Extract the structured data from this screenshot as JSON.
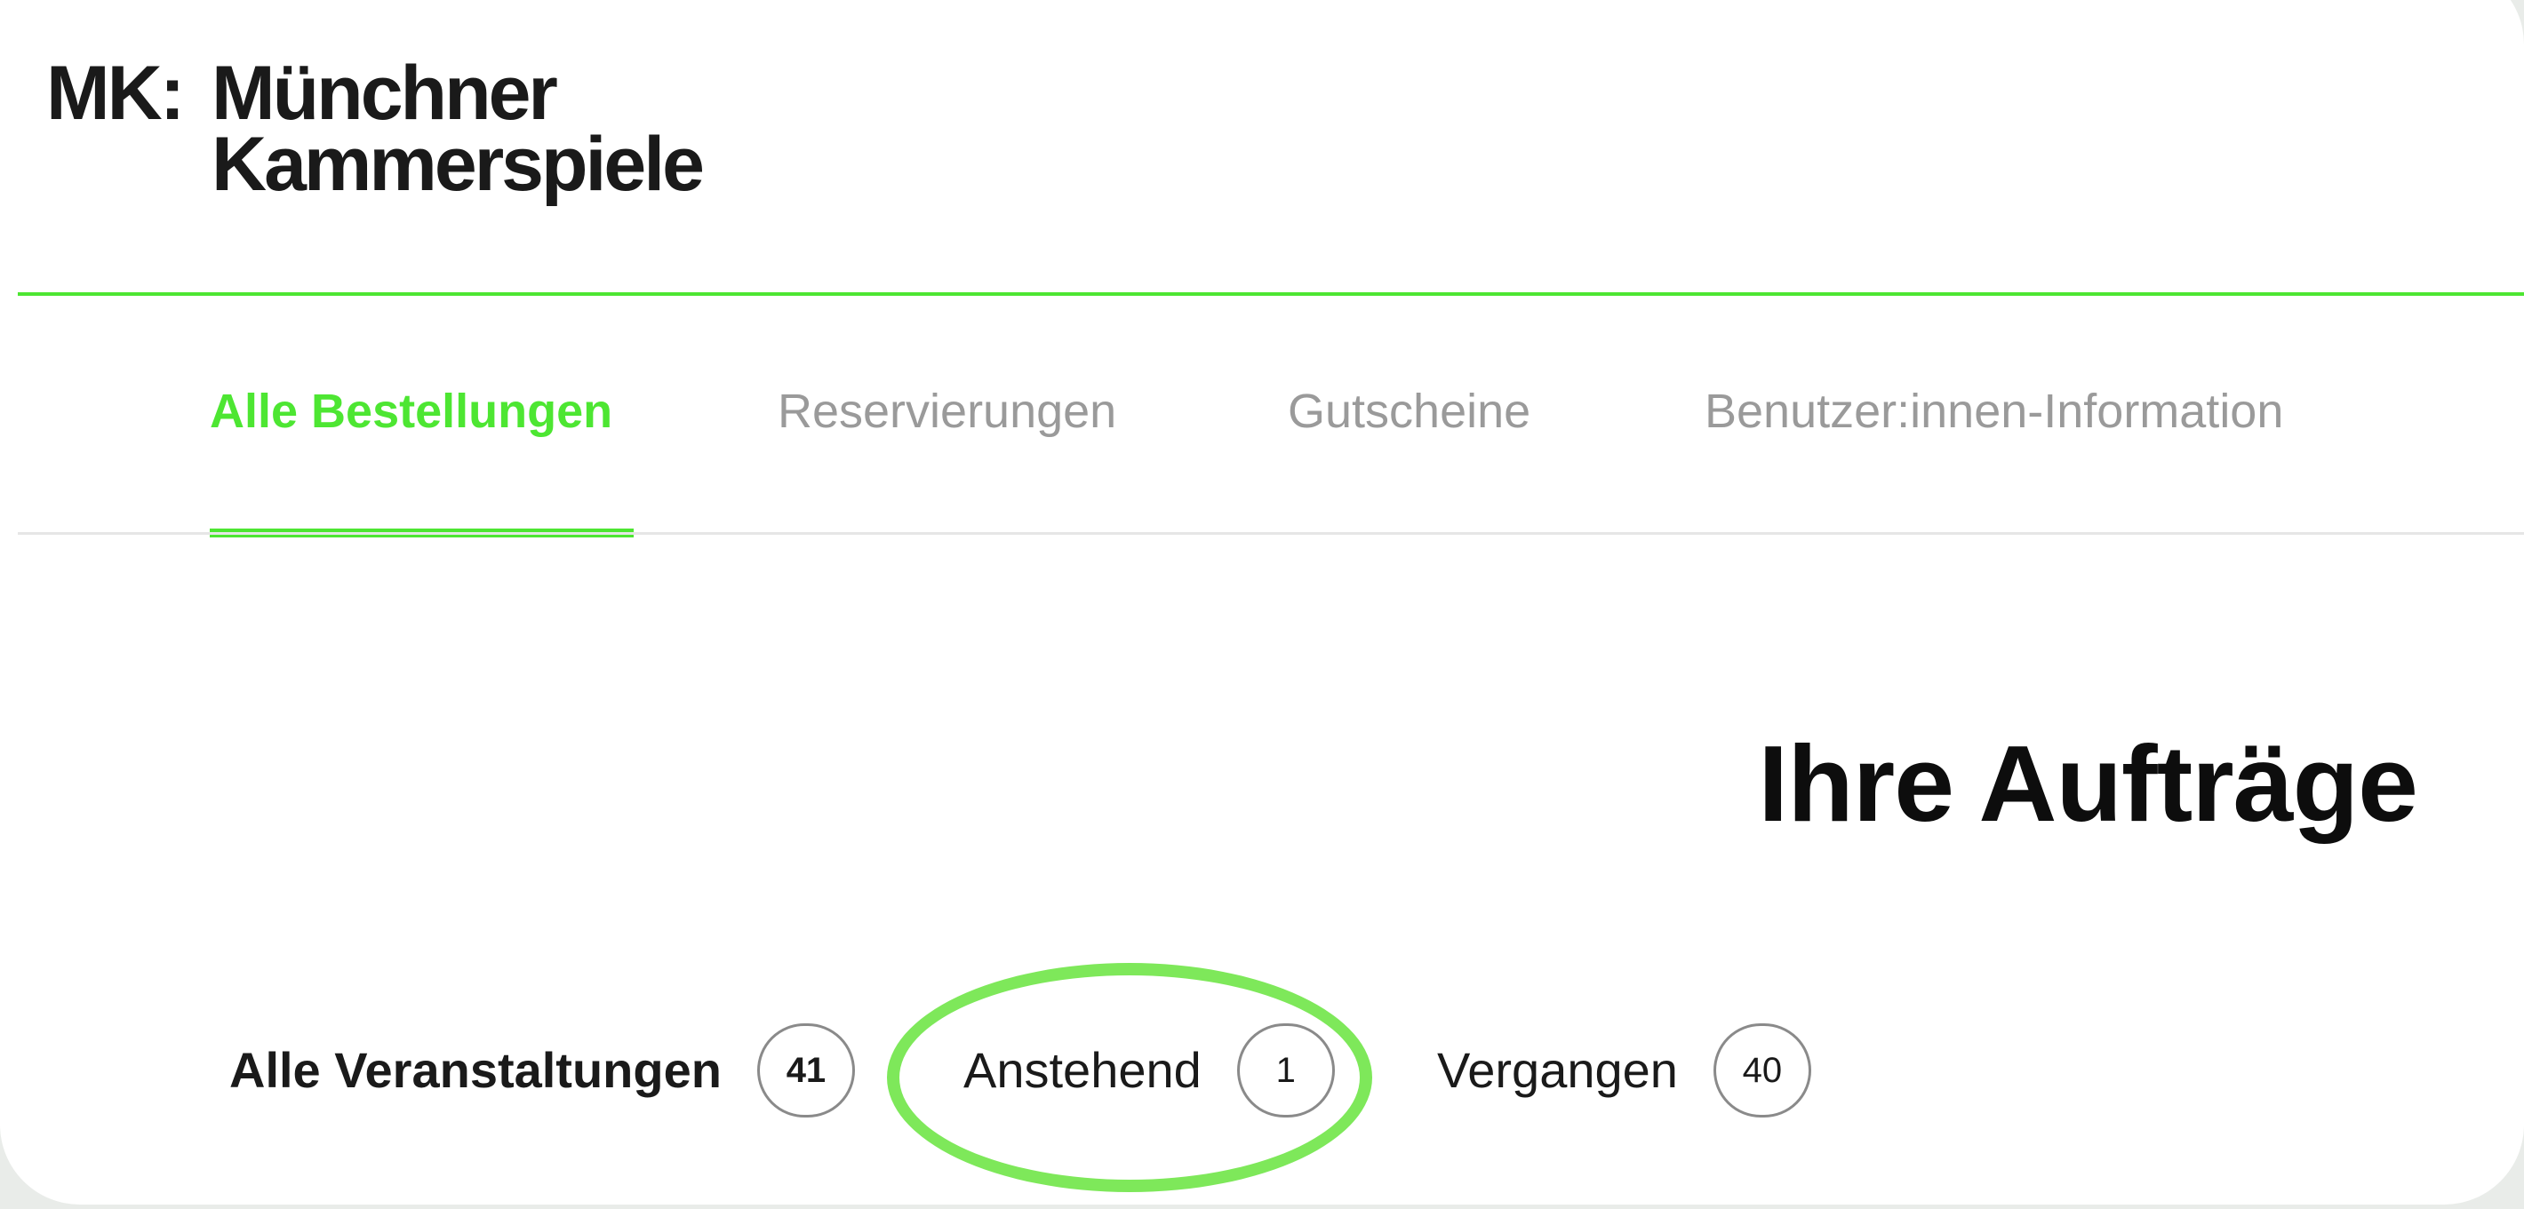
{
  "logo": {
    "prefix": "MK:",
    "line1": "Münchner",
    "line2": "Kammerspiele"
  },
  "colors": {
    "accent": "#4de632",
    "highlight": "#7ee85a",
    "tab_inactive": "#9a9a9a",
    "text": "#1a1a1a"
  },
  "tabs": [
    {
      "label": "Alle Bestellungen",
      "active": true
    },
    {
      "label": "Reservierungen",
      "active": false
    },
    {
      "label": "Gutscheine",
      "active": false
    },
    {
      "label": "Benutzer:innen-Information",
      "active": false
    }
  ],
  "main": {
    "title": "Ihre Aufträge"
  },
  "filters": [
    {
      "label": "Alle Veranstaltungen",
      "count": "41",
      "selected": true
    },
    {
      "label": "Anstehend",
      "count": "1",
      "selected": false,
      "highlighted": true
    },
    {
      "label": "Vergangen",
      "count": "40",
      "selected": false
    }
  ]
}
